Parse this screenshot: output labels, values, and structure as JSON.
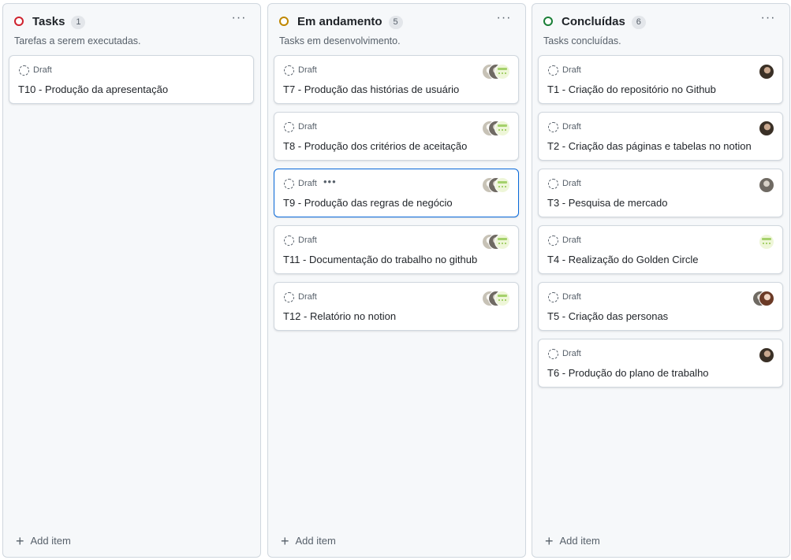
{
  "columns": [
    {
      "title": "Tasks",
      "count": "1",
      "status_color": "#cf222e",
      "description": "Tarefas a serem executadas.",
      "add_label": "Add item",
      "cards": [
        {
          "status": "Draft",
          "title": "T10 - Produção da apresentação",
          "avatars": []
        }
      ]
    },
    {
      "title": "Em andamento",
      "count": "5",
      "status_color": "#bf8700",
      "description": "Tasks em desenvolvimento.",
      "add_label": "Add item",
      "cards": [
        {
          "status": "Draft",
          "title": "T7 - Produção das histórias de usuário",
          "avatars": [
            "light",
            "gray",
            "green"
          ]
        },
        {
          "status": "Draft",
          "title": "T8 - Produção dos critérios de aceitação",
          "avatars": [
            "light",
            "gray",
            "green"
          ]
        },
        {
          "status": "Draft",
          "title": "T9 - Produção das regras de negócio",
          "avatars": [
            "light",
            "gray",
            "green"
          ],
          "active": true,
          "menu": "•••"
        },
        {
          "status": "Draft",
          "title": "T11 - Documentação do trabalho no github",
          "avatars": [
            "light",
            "gray",
            "green"
          ]
        },
        {
          "status": "Draft",
          "title": "T12 - Relatório no notion",
          "avatars": [
            "light",
            "gray",
            "green"
          ]
        }
      ]
    },
    {
      "title": "Concluídas",
      "count": "6",
      "status_color": "#1a7f37",
      "description": "Tasks concluídas.",
      "add_label": "Add item",
      "cards": [
        {
          "status": "Draft",
          "title": "T1 - Criação do repositório no Github",
          "avatars": [
            "dark"
          ]
        },
        {
          "status": "Draft",
          "title": "T2 - Criação das páginas e tabelas no notion",
          "avatars": [
            "dark"
          ]
        },
        {
          "status": "Draft",
          "title": "T3 - Pesquisa de mercado",
          "avatars": [
            "gray"
          ]
        },
        {
          "status": "Draft",
          "title": "T4 - Realização do Golden Circle",
          "avatars": [
            "green"
          ]
        },
        {
          "status": "Draft",
          "title": "T5 - Criação das personas",
          "avatars": [
            "gray",
            "brown"
          ]
        },
        {
          "status": "Draft",
          "title": "T6 - Produção do plano de trabalho",
          "avatars": [
            "dark"
          ]
        }
      ]
    }
  ],
  "column_menu_label": "···"
}
